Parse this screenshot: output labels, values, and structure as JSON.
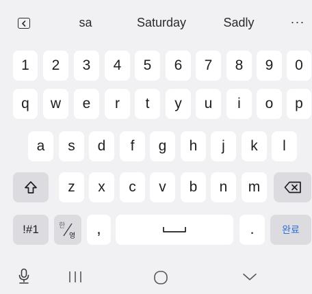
{
  "suggestions": {
    "toggle_icon": "chevron-left-icon",
    "words": [
      "sa",
      "Saturday",
      "Sadly"
    ],
    "more": "···"
  },
  "keyboard": {
    "numbers": [
      "1",
      "2",
      "3",
      "4",
      "5",
      "6",
      "7",
      "8",
      "9",
      "0"
    ],
    "row1": [
      "q",
      "w",
      "e",
      "r",
      "t",
      "y",
      "u",
      "i",
      "o",
      "p"
    ],
    "row2": [
      "a",
      "s",
      "d",
      "f",
      "g",
      "h",
      "j",
      "k",
      "l"
    ],
    "row3": [
      "z",
      "x",
      "c",
      "v",
      "b",
      "n",
      "m"
    ],
    "symbols_label": "!#1",
    "lang_top": "한",
    "lang_bottom": "영",
    "comma": ",",
    "period": ".",
    "done_label": "완료",
    "shift_icon": "shift-icon",
    "backspace_icon": "backspace-icon",
    "space_icon": "space-bar-icon"
  },
  "navigation": {
    "mic_icon": "microphone-icon",
    "recents_icon": "recent-apps-icon",
    "home_icon": "home-icon",
    "hide_icon": "chevron-down-icon"
  },
  "colors": {
    "background": "#f1f1f3",
    "key": "#ffffff",
    "function_key": "#dcdce0",
    "accent": "#2f6fd8"
  }
}
